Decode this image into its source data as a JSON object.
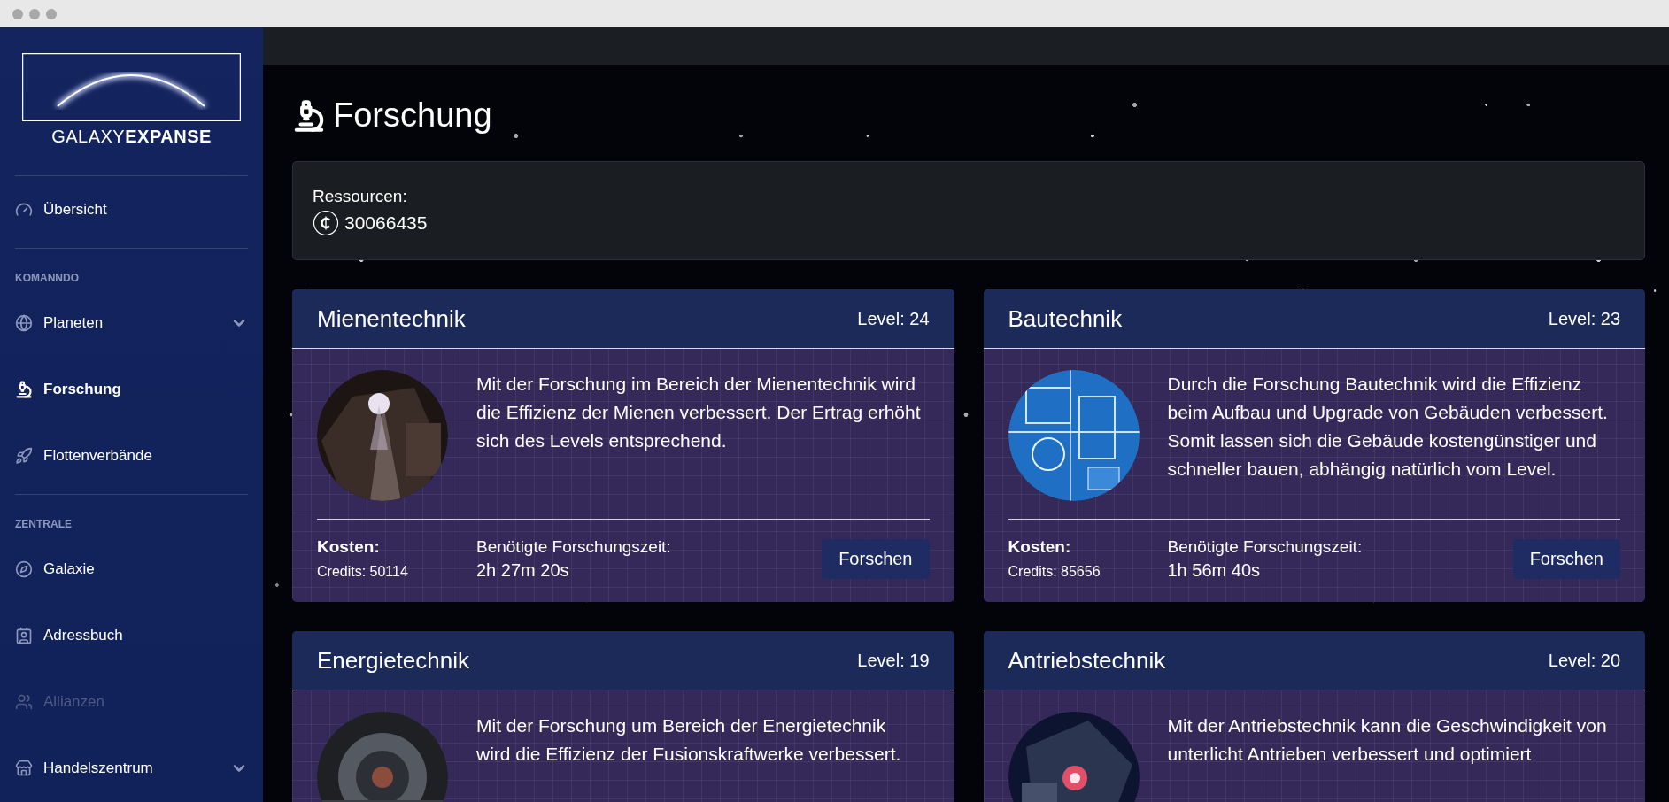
{
  "logo": {
    "text": "GALAXY**EXPANSE**"
  },
  "sidebar": {
    "sections": [
      {
        "items": [
          {
            "label": "Übersicht",
            "selected": false,
            "disabled": false,
            "expandable": false
          }
        ]
      },
      {
        "heading": "KOMANNDO",
        "items": [
          {
            "label": "Planeten",
            "selected": false,
            "disabled": false,
            "expandable": true
          },
          {
            "label": "Forschung",
            "selected": true,
            "disabled": false,
            "expandable": false
          },
          {
            "label": "Flottenverbände",
            "selected": false,
            "disabled": false,
            "expandable": false
          }
        ]
      },
      {
        "heading": "ZENTRALE",
        "items": [
          {
            "label": "Galaxie",
            "selected": false,
            "disabled": false,
            "expandable": false
          },
          {
            "label": "Adressbuch",
            "selected": false,
            "disabled": false,
            "expandable": false
          },
          {
            "label": "Allianzen",
            "selected": false,
            "disabled": true,
            "expandable": false
          },
          {
            "label": "Handelszentrum",
            "selected": false,
            "disabled": false,
            "expandable": true
          }
        ]
      }
    ]
  },
  "page": {
    "title": "Forschung"
  },
  "resources": {
    "label": "Ressourcen:",
    "credits": "30066435"
  },
  "research": [
    {
      "name": "Mienentechnik",
      "level": "Level: 24",
      "description": "Mit der Forschung im Bereich der Mienentechnik wird die Effizienz der Mienen verbessert. Der Ertrag erhöht sich des Levels entsprechend.",
      "cost_label": "Kosten:",
      "cost": "Credits: 50114",
      "time_label": "Benötigte Forschungszeit:",
      "time": "2h 27m 20s",
      "button": "Forschen"
    },
    {
      "name": "Bautechnik",
      "level": "Level: 23",
      "description": "Durch die Forschung Bautechnik wird die Effizienz beim Aufbau und Upgrade von Gebäuden verbessert. Somit lassen sich die Gebäude kostengünstiger und schneller bauen, abhängig natürlich vom Level.",
      "cost_label": "Kosten:",
      "cost": "Credits: 85656",
      "time_label": "Benötigte Forschungszeit:",
      "time": "1h 56m 40s",
      "button": "Forschen"
    },
    {
      "name": "Energietechnik",
      "level": "Level: 19",
      "description": "Mit der Forschung um Bereich der Energietechnik wird die Effizienz der Fusionskraftwerke verbessert."
    },
    {
      "name": "Antriebstechnik",
      "level": "Level: 20",
      "description": "Mit der Antriebstechnik kann die Geschwindigkeit von unterlicht Antrieben verbessert und optimiert"
    }
  ]
}
